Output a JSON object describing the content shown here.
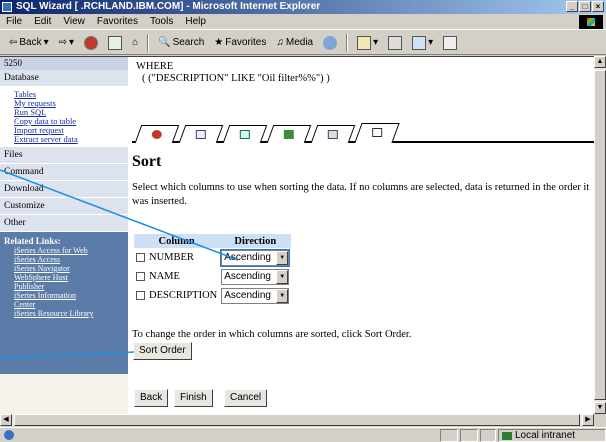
{
  "window": {
    "title": "SQL Wizard [          .RCHLAND.IBM.COM] - Microsoft Internet Explorer",
    "min": "_",
    "max": "□",
    "close": "×"
  },
  "menu": {
    "items": [
      "File",
      "Edit",
      "View",
      "Favorites",
      "Tools",
      "Help"
    ]
  },
  "toolbar": {
    "back": "Back",
    "search": "Search",
    "favorites": "Favorites",
    "media": "Media"
  },
  "sidebar": {
    "system": "5250",
    "sections": [
      {
        "label": "Database"
      },
      {
        "label": "Files"
      },
      {
        "label": "Command"
      },
      {
        "label": "Download"
      },
      {
        "label": "Customize"
      },
      {
        "label": "Other"
      }
    ],
    "database_links": [
      "Tables",
      "My requests",
      "Run SQL",
      "Copy data to table",
      "Import request",
      "Extract server data"
    ],
    "related_title": "Related Links:",
    "related_links": [
      "iSeries Access for Web",
      "iSeries Access",
      "iSeries Navigator",
      "WebSphere Host",
      "Publisher",
      "iSeries Information",
      "Center",
      "iSeries Resource Library"
    ]
  },
  "main": {
    "where_keyword": "WHERE",
    "where_clause": "( (\"DESCRIPTION\" LIKE \"Oil filter%%\") )",
    "heading": "Sort",
    "description": "Select which columns to use when sorting the data. If no columns are selected, data is returned in the order it was inserted.",
    "table": {
      "col_header": "Column",
      "dir_header": "Direction",
      "rows": [
        {
          "name": "NUMBER",
          "direction": "Ascending"
        },
        {
          "name": "NAME",
          "direction": "Ascending"
        },
        {
          "name": "DESCRIPTION",
          "direction": "Ascending"
        }
      ]
    },
    "order_note": "To change the order in which columns are sorted, click Sort Order.",
    "sort_order_btn": "Sort Order",
    "back_btn": "Back",
    "finish_btn": "Finish",
    "cancel_btn": "Cancel"
  },
  "status": {
    "zone": "Local intranet"
  },
  "colors": {
    "callout": "#1c8fe0",
    "table_header": "#cde0f6",
    "related_bg": "#5b7ba8"
  }
}
